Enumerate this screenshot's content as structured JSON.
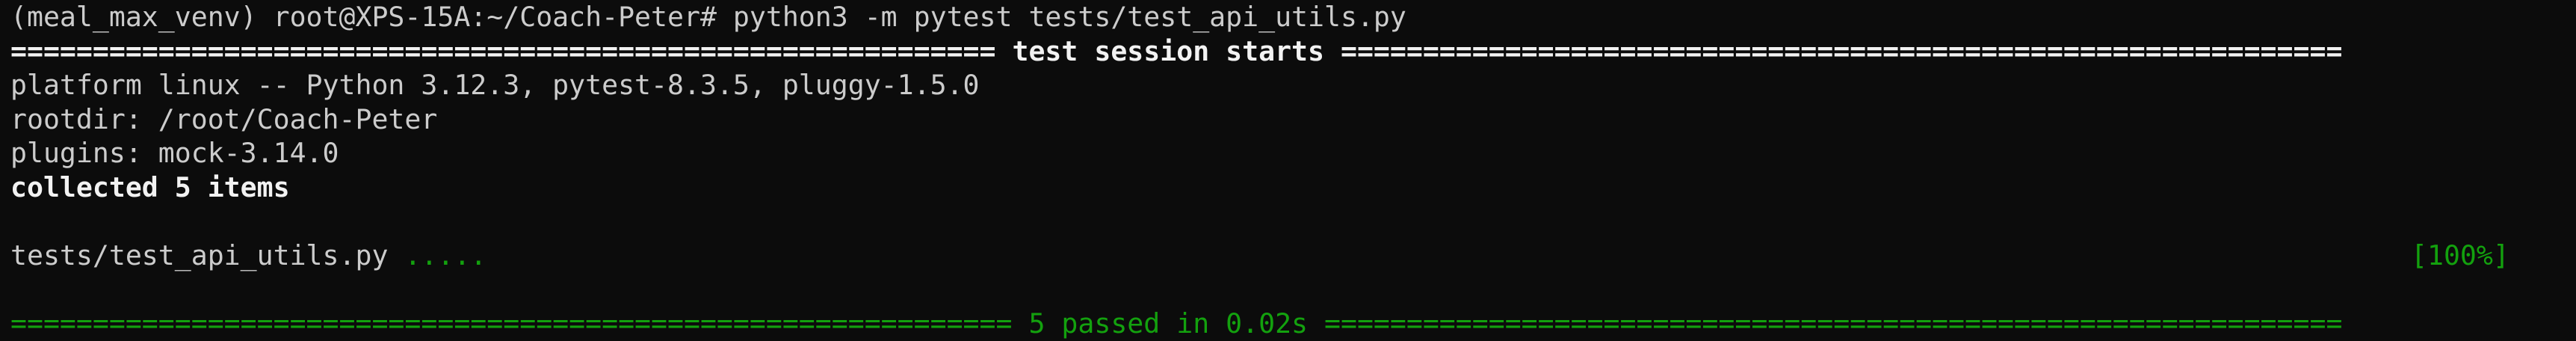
{
  "terminal": {
    "prompt_line": "(meal_max_venv) root@XPS-15A:~/Coach-Peter# python3 -m pytest tests/test_api_utils.py",
    "session_header": "============================================================ test session starts =============================================================",
    "platform_line": "platform linux -- Python 3.12.3, pytest-8.3.5, pluggy-1.5.0",
    "rootdir_line": "rootdir: /root/Coach-Peter",
    "plugins_line": "plugins: mock-3.14.0",
    "collected_line": "collected 5 items",
    "blank_line": "",
    "test_file": "tests/test_api_utils.py",
    "test_dots": ".....",
    "progress": "[100%]",
    "summary_line": "============================================================= 5 passed in 0.02s =============================================================="
  },
  "colors": {
    "background": "#0c0c0c",
    "text": "#cccccc",
    "bold_text": "#f2f2f2",
    "pass_green": "#13a10e"
  }
}
